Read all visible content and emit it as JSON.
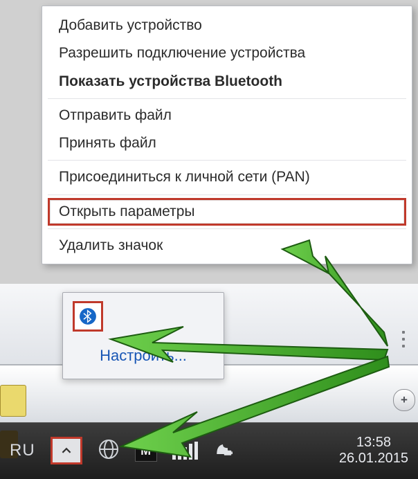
{
  "menu": {
    "add_device": "Добавить устройство",
    "allow_connect": "Разрешить подключение устройства",
    "show_bt": "Показать устройства Bluetooth",
    "send_file": "Отправить файл",
    "receive_file": "Принять файл",
    "join_pan": "Присоединиться к личной сети (PAN)",
    "open_settings": "Открыть параметры",
    "remove_icon": "Удалить значок"
  },
  "tray_popup": {
    "configure": "Настроить..."
  },
  "taskbar": {
    "lang": "RU",
    "time": "13:58",
    "date": "26.01.2015"
  },
  "icons": {
    "bluetooth": "bluetooth-icon",
    "show_hidden": "show-hidden-tray-icon",
    "globe": "network-globe-icon",
    "signal": "wifi-signal-icon",
    "power": "power-battery-icon"
  },
  "highlight_color": "#c0392b",
  "arrow_color": "#3fae29"
}
